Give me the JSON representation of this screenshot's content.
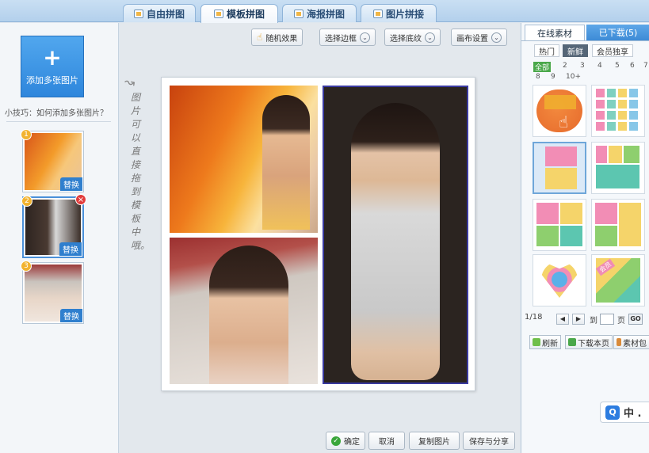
{
  "tabs": [
    {
      "label": "自由拼图",
      "active": false
    },
    {
      "label": "模板拼图",
      "active": true
    },
    {
      "label": "海报拼图",
      "active": false
    },
    {
      "label": "图片拼接",
      "active": false
    }
  ],
  "left": {
    "add_label": "添加多张图片",
    "tip": "小技巧：如何添加多张图片？",
    "thumbs": [
      {
        "badge": "1",
        "replace": "替换"
      },
      {
        "badge": "2",
        "replace": "替换",
        "delete": "×"
      },
      {
        "badge": "3",
        "replace": "替换"
      }
    ]
  },
  "toolbar": {
    "random": "随机效果",
    "border": "选择边框",
    "texture": "选择底纹",
    "canvas": "画布设置"
  },
  "hint": {
    "arrow": "↝",
    "text": "图片可以直接拖到模板中哦。"
  },
  "bottom": {
    "ok": "确定",
    "cancel": "取消",
    "copy": "复制图片",
    "save": "保存与分享"
  },
  "right": {
    "tab_online": "在线素材",
    "tab_downloaded": "已下载(5)",
    "filters": [
      "热门",
      "新鲜",
      "会员独享"
    ],
    "numbers_row1": [
      "全部",
      "2",
      "3",
      "4",
      "5",
      "6",
      "7"
    ],
    "numbers_row2": [
      "8",
      "9",
      "10+"
    ],
    "pager": {
      "page": "1/18",
      "prev": "◀",
      "next": "▶",
      "to": "到",
      "unit": "页",
      "go": "GO"
    },
    "actions": {
      "refresh": "刷新",
      "download": "下载本页",
      "pack": "素材包"
    },
    "ime": {
      "q": "Q",
      "text": "中 ."
    },
    "template_tag": "会员"
  },
  "colors": {
    "accent": "#3d8bd6",
    "pink": "#f08cb4",
    "green": "#8ecf6e",
    "teal": "#5cc6b0",
    "yellow": "#f5d46a",
    "orange": "#f07a3a"
  }
}
